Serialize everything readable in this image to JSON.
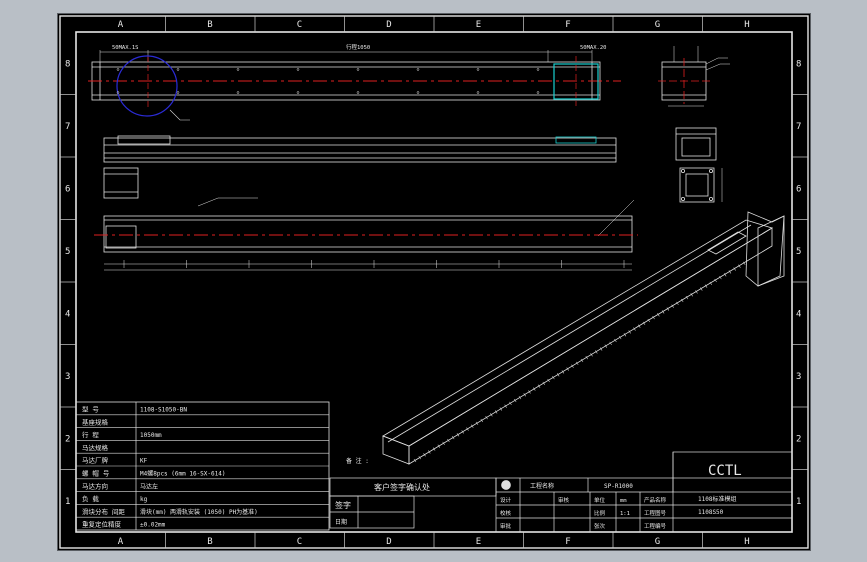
{
  "drawing": {
    "colors": {
      "background": "#000000",
      "frame": "#e6e6e6",
      "geometry": "#e0e0e0",
      "centerline": "#e02020",
      "highlight_circle": "#2b2bd6",
      "highlight_box": "#19d0d0"
    },
    "zone_columns": [
      "A",
      "B",
      "C",
      "D",
      "E",
      "F",
      "G",
      "H"
    ],
    "zone_rows": [
      "8",
      "7",
      "6",
      "5",
      "4",
      "3",
      "2",
      "1"
    ],
    "top_view_dims": {
      "left": "50MAX.1S",
      "middle": "行程1050",
      "right": "50MAX.20"
    },
    "note_label": "备 注 :",
    "logo_text": "CCTL"
  },
  "spec_table": {
    "rows": [
      {
        "label": "型  号",
        "value": "1108-S1050-BN"
      },
      {
        "label": "基座规格",
        "value": ""
      },
      {
        "label": "行  程",
        "value": "1050mm"
      },
      {
        "label": "马达规格",
        "value": ""
      },
      {
        "label": "马达厂牌",
        "value": "KF"
      },
      {
        "label": "螺 帽 号",
        "value": "M4螺8pcs (6mm 16-SX-614)"
      },
      {
        "label": "马达方向",
        "value": "马达左"
      },
      {
        "label": "负  载",
        "value": "kg"
      },
      {
        "label": "滑块分布 间距",
        "value": "滑块(mm)  两滑轨安装 (1050) PH为基准)"
      },
      {
        "label": "重复定位精度",
        "value": "±0.02mm"
      }
    ]
  },
  "approval": {
    "header": "客户签字确认处",
    "sign_label": "签字",
    "date_label": "日期"
  },
  "title_block": {
    "project_label": "工程名称",
    "project_value": "SP-R1000",
    "rows": [
      {
        "a": "设计",
        "b": "审核",
        "c": "单位",
        "d": "mm",
        "e": "产品名称"
      },
      {
        "a": "校核",
        "b": "",
        "c": "比例",
        "d": "1:1",
        "e": "工程图号"
      },
      {
        "a": "审批",
        "b": "",
        "c": "张次",
        "d": "",
        "e": "工程编号"
      }
    ],
    "product_name": "1108标准模组",
    "drawing_number": "1108S50"
  }
}
